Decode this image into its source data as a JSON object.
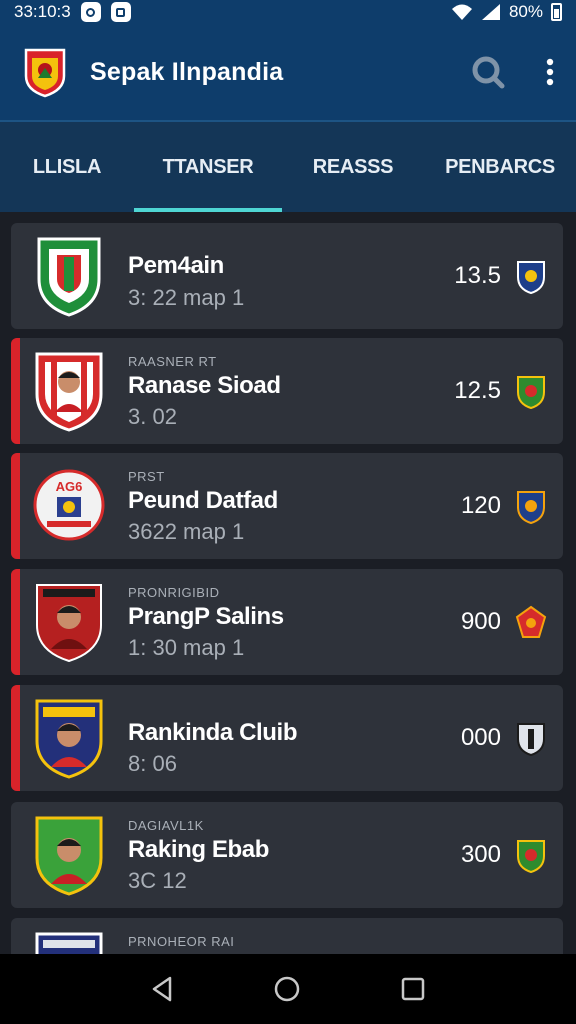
{
  "status": {
    "time": "33:10:3",
    "battery": "80%"
  },
  "app": {
    "title": "Sepak Ilnpandia"
  },
  "icons": {
    "search": "search-icon",
    "menu": "more-vertical-icon",
    "back": "back-icon",
    "home": "home-icon",
    "recents": "recents-icon"
  },
  "tabs": [
    {
      "label": "LLISLA",
      "active": false
    },
    {
      "label": "TTANSER",
      "active": true
    },
    {
      "label": "REASSS",
      "active": false
    },
    {
      "label": "PENBARCS",
      "active": false
    }
  ],
  "clubs": [
    {
      "small": "",
      "name": "Pem4ain",
      "sub": "3: 22 map 1",
      "score": "13.5",
      "accent": false,
      "badge_color": "#1f8f3a",
      "mini_color": "#1e3f8a"
    },
    {
      "small": "RAASNER RT",
      "name": "Ranase Sioad",
      "sub": "3. 02",
      "score": "12.5",
      "accent": true,
      "badge_color": "#d62b2b",
      "mini_color": "#2e8b2e"
    },
    {
      "small": "PRST",
      "name": "Peund Datfad",
      "sub": "3622 map 1",
      "score": "120",
      "accent": true,
      "badge_color": "#f2f2f2",
      "mini_color": "#1e3f8a"
    },
    {
      "small": "PRONRIGIBID",
      "name": "PrangP Salins",
      "sub": "1: 30 map 1",
      "score": "900",
      "accent": true,
      "badge_color": "#b52020",
      "mini_color": "#d62b2b"
    },
    {
      "small": "",
      "name": "Rankinda Cluib",
      "sub": "8: 06",
      "score": "000",
      "accent": true,
      "badge_color": "#23307a",
      "mini_color": "#dfe3ea"
    },
    {
      "small": "DAGIAVL1K",
      "name": "Raking Ebab",
      "sub": "3C 12",
      "score": "300",
      "accent": false,
      "badge_color": "#3aa23a",
      "mini_color": "#2e8b2e"
    },
    {
      "small": "PRNOHEOR RAI",
      "name": "",
      "sub": "",
      "score": "",
      "accent": false,
      "badge_color": "#23307a",
      "mini_color": "#dfe3ea"
    }
  ]
}
